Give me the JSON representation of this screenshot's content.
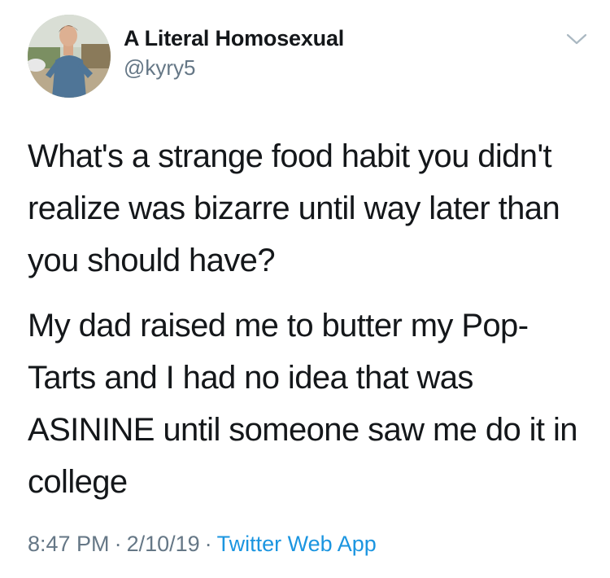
{
  "tweet": {
    "display_name": "A Literal Homosexual",
    "handle": "@kyry5",
    "avatar_icon": "profile-photo",
    "menu_icon": "chevron-down-icon",
    "paragraphs": [
      "What's a strange food habit you didn't realize was bizarre until way later than you should have?",
      "My dad raised me to butter my Pop-Tarts and I had no idea that was ASININE until someone saw me do it in college"
    ],
    "time": "8:47 PM",
    "date": "2/10/19",
    "separator": "·",
    "source": "Twitter Web App"
  },
  "colors": {
    "text": "#14171a",
    "secondary": "#657786",
    "link": "#1b95e0",
    "background": "#ffffff"
  }
}
